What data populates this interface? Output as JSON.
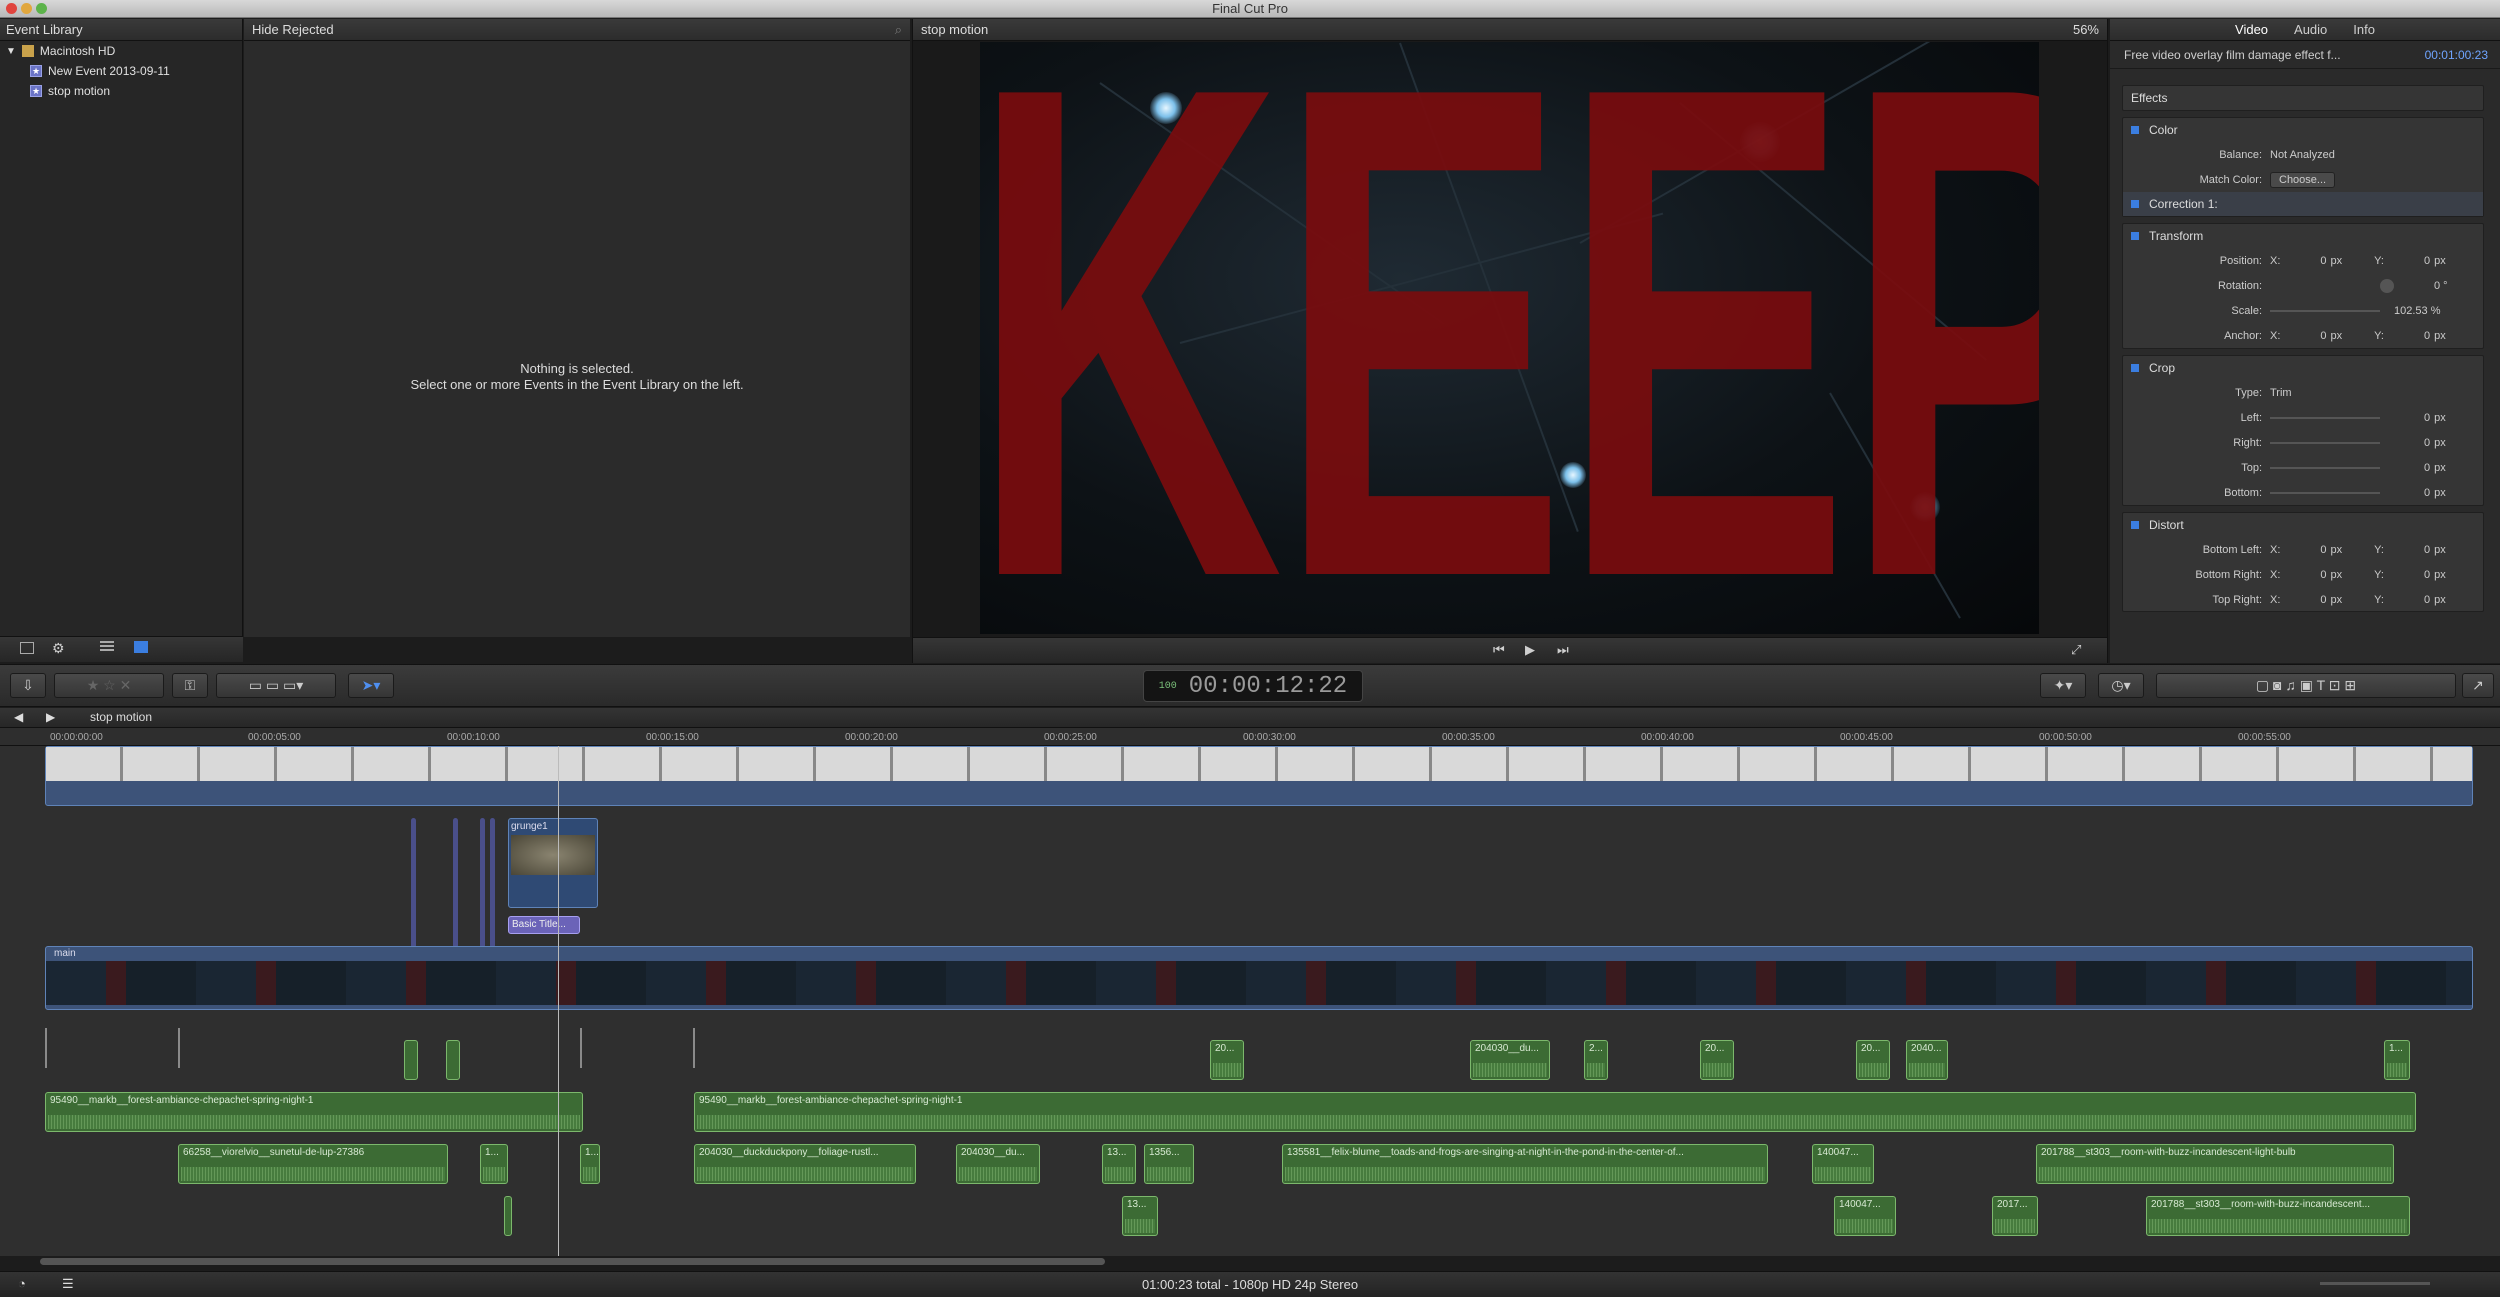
{
  "app": {
    "title": "Final Cut Pro"
  },
  "library": {
    "header": "Event Library",
    "items": [
      {
        "label": "Macintosh HD",
        "type": "drive"
      },
      {
        "label": "New Event 2013-09-11",
        "type": "event"
      },
      {
        "label": "stop motion",
        "type": "event"
      }
    ]
  },
  "browser": {
    "filter": "Hide Rejected",
    "empty_line1": "Nothing is selected.",
    "empty_line2": "Select one or more Events in the Event Library on the left."
  },
  "viewer": {
    "title": "stop motion",
    "zoom": "56%",
    "title_text": "KEEPER"
  },
  "inspector": {
    "tabs": [
      "Video",
      "Audio",
      "Info"
    ],
    "clip_name": "Free video overlay film damage effect f...",
    "clip_time": "00:01:00:23",
    "effects_label": "Effects",
    "color": {
      "label": "Color",
      "balance_label": "Balance:",
      "balance_value": "Not Analyzed",
      "match_label": "Match Color:",
      "match_button": "Choose...",
      "correction": "Correction 1:"
    },
    "transform": {
      "label": "Transform",
      "position_label": "Position:",
      "x": "X:",
      "x_val": "0",
      "y": "Y:",
      "y_val": "0",
      "unit": "px",
      "rotation_label": "Rotation:",
      "rotation_val": "0 °",
      "scale_label": "Scale:",
      "scale_val": "102.53 %",
      "anchor_label": "Anchor:"
    },
    "crop": {
      "label": "Crop",
      "type_label": "Type:",
      "type_value": "Trim",
      "left": "Left:",
      "right": "Right:",
      "top": "Top:",
      "bottom": "Bottom:",
      "val": "0",
      "unit": "px"
    },
    "distort": {
      "label": "Distort",
      "bl": "Bottom Left:",
      "br": "Bottom Right:",
      "tr": "Top Right:"
    }
  },
  "toolbar": {
    "timecode": "00:00:12:22",
    "tc_hr": "100"
  },
  "timeline": {
    "project": "stop motion",
    "ticks": [
      "00:00:00:00",
      "00:00:05:00",
      "00:00:10:00",
      "00:00:15:00",
      "00:00:20:00",
      "00:00:25:00",
      "00:00:30:00",
      "00:00:35:00",
      "00:00:40:00",
      "00:00:45:00",
      "00:00:50:00",
      "00:00:55:00"
    ],
    "storyline_label": "main",
    "clips": {
      "grunge": "grunge1",
      "title": "Basic Title...",
      "a1": "95490__markb__forest-ambiance-chepachet-spring-night-1",
      "a2": "95490__markb__forest-ambiance-chepachet-spring-night-1",
      "a3": "66258__viorelvio__sunetul-de-lup-27386",
      "a4": "204030__duckduckpony__foliage-rustl...",
      "a5": "204030__du...",
      "a6": "135581__felix-blume__toads-and-frogs-are-singing-at-night-in-the-pond-in-the-center-of...",
      "a7": "140047...",
      "a8": "201788__st303__room-with-buzz-incandescent-light-bulb",
      "a9": "201788__st303__room-with-buzz-incandescent...",
      "a10": "140047...",
      "a11": "2017...",
      "a12": "1356...",
      "a13": "13...",
      "a14": "13...",
      "a15": "1...",
      "a16": "1...",
      "s1": "20...",
      "s2": "204030__du...",
      "s3": "2...",
      "s4": "20...",
      "s5": "20...",
      "s6": "2040...",
      "s7": "1..."
    }
  },
  "status": {
    "summary": "01:00:23 total - 1080p HD 24p Stereo"
  }
}
